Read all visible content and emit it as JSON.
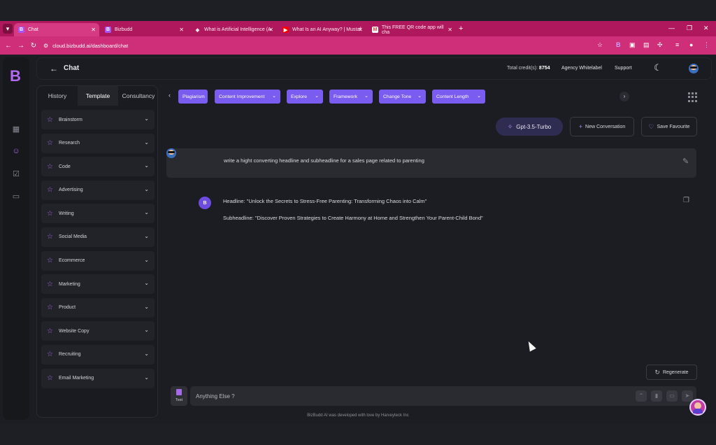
{
  "browser": {
    "tabs": [
      {
        "title": "Chat",
        "favicon": "B",
        "color": "#a855f7"
      },
      {
        "title": "Bizbudd",
        "favicon": "B",
        "color": "#a855f7"
      },
      {
        "title": "What is Artificial Intelligence (A",
        "favicon": "◆",
        "color": "#e5e7eb"
      },
      {
        "title": "What Is an AI Anyway? | Mustaf",
        "favicon": "▶",
        "color": "#ff0000"
      },
      {
        "title": "This FREE QR code app will cha",
        "favicon": "M",
        "color": "#ea4335"
      }
    ],
    "url": "cloud.bizbudd.ai/dashboard/chat"
  },
  "header": {
    "title": "Chat",
    "credits_label": "Total credit(s):",
    "credits_value": "8754",
    "agency_link": "Agency Whitelabel",
    "support_link": "Support"
  },
  "sidebar": {
    "logo": "B",
    "tabs": [
      "History",
      "Template",
      "Consultancy"
    ],
    "active_tab": "Template",
    "categories": [
      "Brainstorm",
      "Research",
      "Code",
      "Advertising",
      "Writing",
      "Social Media",
      "Ecommerce",
      "Marketing",
      "Product",
      "Website Copy",
      "Recruiting",
      "Email Marketing"
    ]
  },
  "toolbar": {
    "chips": [
      "Plagiarism",
      "Content Improvement",
      "Explore",
      "Framework",
      "Change Tone",
      "Content Length"
    ],
    "model": "Gpt-3.5-Turbo",
    "new_conversation": "New Conversation",
    "save_favourite": "Save Favourite"
  },
  "conversation": {
    "user_message": "write a hight converting headline and subheadline for a sales page related to parenting",
    "bot_avatar": "B",
    "bot_lines": [
      "Headline: \"Unlock the Secrets to Stress-Free Parenting: Transforming Chaos into Calm\"",
      "Subheadline: \"Discover Proven Strategies to Create Harmony at Home and Strengthen Your Parent-Child Bond\""
    ]
  },
  "composer": {
    "regenerate": "Regenerate",
    "mode_label": "Text",
    "placeholder": "Anything Else ?"
  },
  "footer": "BizBudd AI was developed with love by Harveyteck Inc",
  "colors": {
    "accent": "#7b5cf0",
    "browser": "#b0185e",
    "background": "#1c1d22"
  }
}
